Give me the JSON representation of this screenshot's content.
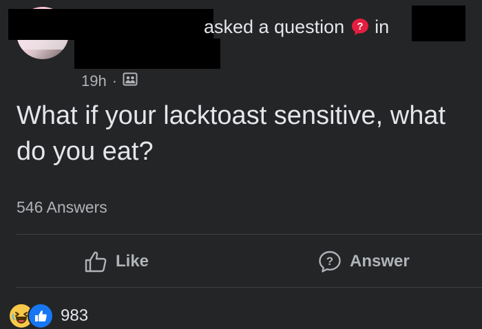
{
  "header": {
    "action_text": "asked a question",
    "in_text": "in",
    "time": "19h",
    "dot": "·",
    "audience_icon": "group-audience-icon",
    "question_badge_icon": "question-badge-icon",
    "badge_color": "#e41e3f"
  },
  "post": {
    "question": "What if your lacktoast sensitive, what do you eat?",
    "answers_count": "546 Answers"
  },
  "actions": {
    "like_label": "Like",
    "answer_label": "Answer"
  },
  "reactions": {
    "count": "983",
    "icons": [
      "haha-reaction-icon",
      "like-reaction-icon"
    ]
  },
  "colors": {
    "background": "#242526",
    "text_primary": "#e4e6eb",
    "text_secondary": "#b0b3b8",
    "like_blue": "#1877f2",
    "haha_yellow": "#f7c94a"
  }
}
